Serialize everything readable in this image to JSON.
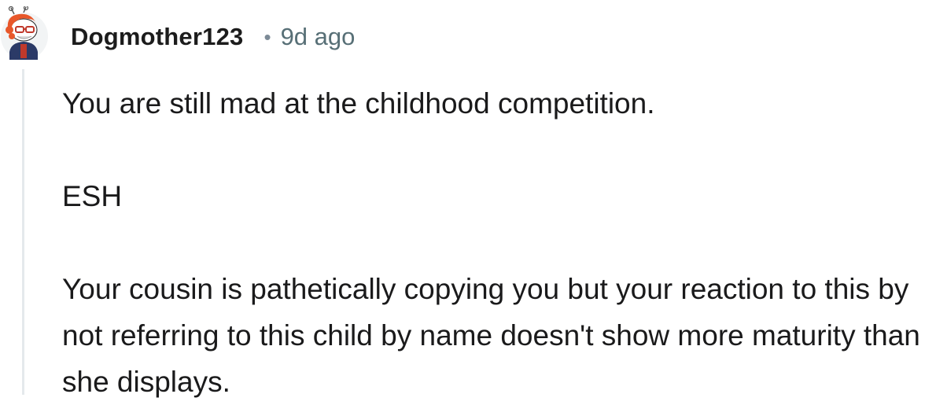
{
  "comment": {
    "username": "Dogmother123",
    "separator": "•",
    "timestamp": "9d ago",
    "avatar_icon": "reddit-snoo-avatar-icon",
    "paragraphs": [
      "You are still mad at the childhood competition.",
      "ESH",
      "Your cousin is pathetically copying you but your reaction to this by not referring to this child by name doesn't show more maturity than she displays."
    ]
  },
  "colors": {
    "username": "#1c1c1c",
    "timestamp": "#576f76",
    "body_text": "#1a1a1b",
    "thread_line": "#e5e9ec",
    "avatar_hair": "#e8572a",
    "avatar_shirt": "#2b3a67"
  }
}
